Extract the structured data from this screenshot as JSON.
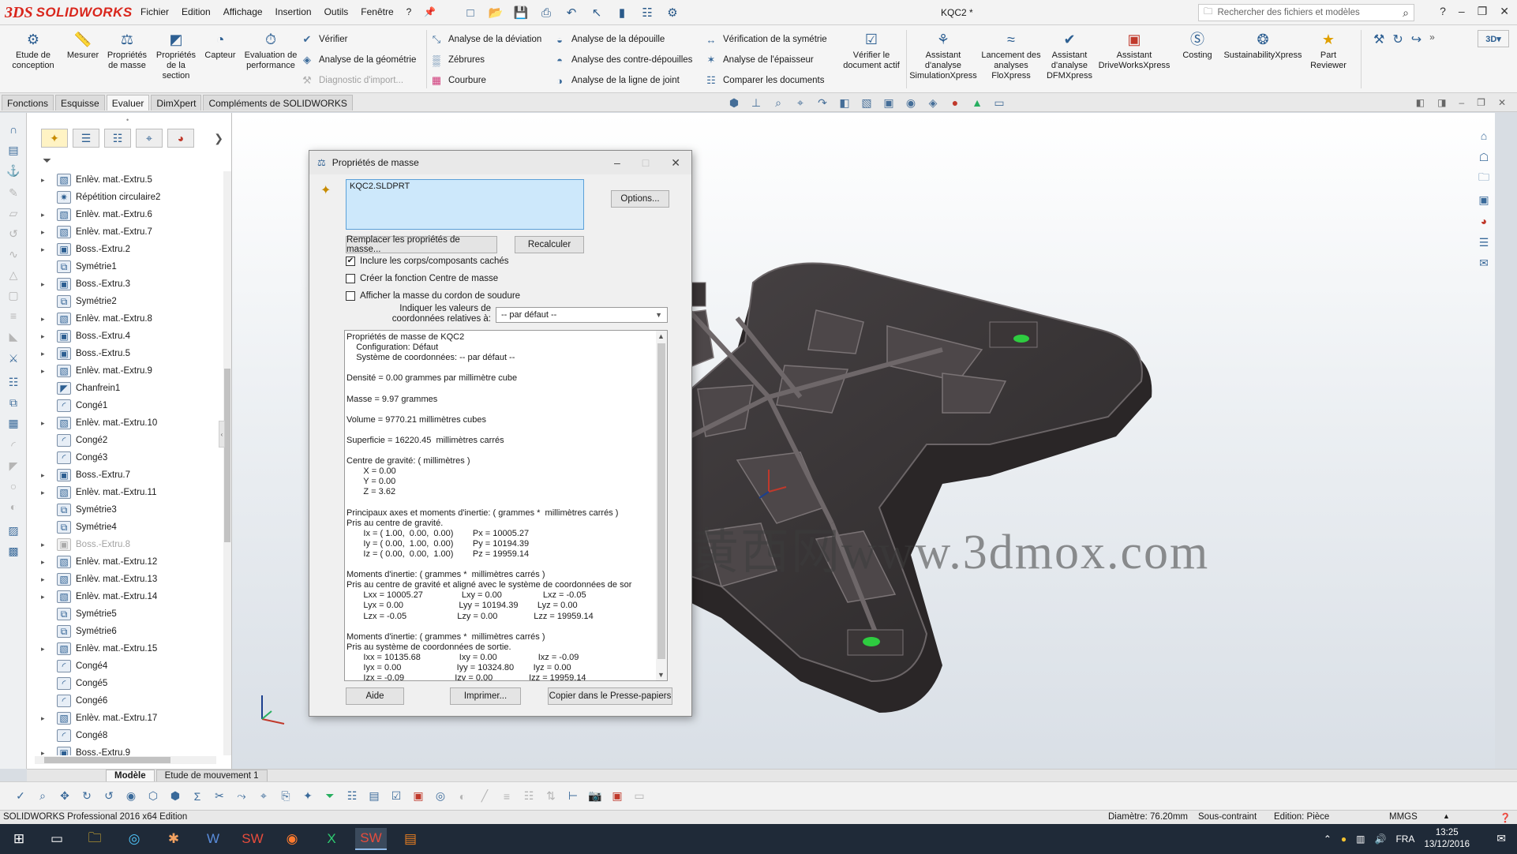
{
  "app": {
    "brand_ds": "3DS",
    "brand_name": "SOLIDWORKS",
    "document_title": "KQC2 *",
    "menu": [
      "Fichier",
      "Edition",
      "Affichage",
      "Insertion",
      "Outils",
      "Fenêtre",
      "?"
    ],
    "search_placeholder": "Rechercher des fichiers et modèles",
    "quick_icons": [
      "new-doc-icon",
      "open-icon",
      "save-icon",
      "print-icon",
      "undo-icon",
      "select-icon",
      "rebuild-icon",
      "file-props-icon",
      "options-icon"
    ]
  },
  "ribbon": {
    "large_buttons": [
      {
        "label": "Etude de conception",
        "icon": "design-study-icon"
      },
      {
        "label": "Mesurer",
        "icon": "measure-icon"
      },
      {
        "label": "Propriétés de masse",
        "icon": "mass-properties-icon"
      },
      {
        "label": "Propriétés de la section",
        "icon": "section-properties-icon"
      },
      {
        "label": "Capteur",
        "icon": "sensor-icon"
      },
      {
        "label": "Evaluation de performance",
        "icon": "performance-icon"
      }
    ],
    "col1": [
      {
        "label": "Vérifier",
        "icon": "check-icon",
        "disabled": false
      },
      {
        "label": "Analyse de la géométrie",
        "icon": "geometry-analysis-icon",
        "disabled": false
      },
      {
        "label": "Diagnostic d'import...",
        "icon": "import-diagnostics-icon",
        "disabled": true
      }
    ],
    "col2": [
      {
        "label": "Analyse de la déviation",
        "icon": "deviation-icon"
      },
      {
        "label": "Zébrures",
        "icon": "zebra-icon"
      },
      {
        "label": "Courbure",
        "icon": "curvature-icon"
      }
    ],
    "col3": [
      {
        "label": "Analyse de la dépouille",
        "icon": "draft-analysis-icon"
      },
      {
        "label": "Analyse des contre-dépouilles",
        "icon": "undercut-icon"
      },
      {
        "label": "Analyse de la ligne de joint",
        "icon": "parting-line-icon"
      }
    ],
    "col4": [
      {
        "label": "Vérification de la symétrie",
        "icon": "symmetry-check-icon"
      },
      {
        "label": "Analyse de l'épaisseur",
        "icon": "thickness-icon"
      },
      {
        "label": "Comparer les documents",
        "icon": "compare-icon"
      }
    ],
    "right_buttons": [
      {
        "label": "Vérifier le document actif",
        "icon": "check-active-doc-icon"
      },
      {
        "label": "Assistant d'analyse SimulationXpress",
        "icon": "simulationxpress-icon"
      },
      {
        "label": "Lancement des analyses FloXpress",
        "icon": "floxpress-icon"
      },
      {
        "label": "Assistant d'analyse DFMXpress",
        "icon": "dfmxpress-icon"
      },
      {
        "label": "Assistant DriveWorksXpress",
        "icon": "driveworks-icon"
      },
      {
        "label": "Costing",
        "icon": "costing-icon"
      },
      {
        "label": "SustainabilityXpress",
        "icon": "sustainability-icon"
      },
      {
        "label": "Part Reviewer",
        "icon": "part-reviewer-icon"
      }
    ]
  },
  "command_tabs": [
    {
      "label": "Fonctions",
      "active": false
    },
    {
      "label": "Esquisse",
      "active": false
    },
    {
      "label": "Evaluer",
      "active": true
    },
    {
      "label": "DimXpert",
      "active": false
    },
    {
      "label": "Compléments de SOLIDWORKS",
      "active": false
    }
  ],
  "tree": [
    {
      "label": "Enlèv. mat.-Extru.5",
      "expandable": true,
      "dim": false,
      "icon": "cut-extrude-icon"
    },
    {
      "label": "Répétition circulaire2",
      "expandable": false,
      "dim": false,
      "icon": "circular-pattern-icon"
    },
    {
      "label": "Enlèv. mat.-Extru.6",
      "expandable": true,
      "dim": false,
      "icon": "cut-extrude-icon"
    },
    {
      "label": "Enlèv. mat.-Extru.7",
      "expandable": true,
      "dim": false,
      "icon": "cut-extrude-icon"
    },
    {
      "label": "Boss.-Extru.2",
      "expandable": true,
      "dim": false,
      "icon": "boss-extrude-icon"
    },
    {
      "label": "Symétrie1",
      "expandable": false,
      "dim": false,
      "icon": "mirror-icon"
    },
    {
      "label": "Boss.-Extru.3",
      "expandable": true,
      "dim": false,
      "icon": "boss-extrude-icon"
    },
    {
      "label": "Symétrie2",
      "expandable": false,
      "dim": false,
      "icon": "mirror-icon"
    },
    {
      "label": "Enlèv. mat.-Extru.8",
      "expandable": true,
      "dim": false,
      "icon": "cut-extrude-icon"
    },
    {
      "label": "Boss.-Extru.4",
      "expandable": true,
      "dim": false,
      "icon": "boss-extrude-icon"
    },
    {
      "label": "Boss.-Extru.5",
      "expandable": true,
      "dim": false,
      "icon": "boss-extrude-icon"
    },
    {
      "label": "Enlèv. mat.-Extru.9",
      "expandable": true,
      "dim": false,
      "icon": "cut-extrude-icon"
    },
    {
      "label": "Chanfrein1",
      "expandable": false,
      "dim": false,
      "icon": "chamfer-icon"
    },
    {
      "label": "Congé1",
      "expandable": false,
      "dim": false,
      "icon": "fillet-icon"
    },
    {
      "label": "Enlèv. mat.-Extru.10",
      "expandable": true,
      "dim": false,
      "icon": "cut-extrude-icon"
    },
    {
      "label": "Congé2",
      "expandable": false,
      "dim": false,
      "icon": "fillet-icon"
    },
    {
      "label": "Congé3",
      "expandable": false,
      "dim": false,
      "icon": "fillet-icon"
    },
    {
      "label": "Boss.-Extru.7",
      "expandable": true,
      "dim": false,
      "icon": "boss-extrude-icon"
    },
    {
      "label": "Enlèv. mat.-Extru.11",
      "expandable": true,
      "dim": false,
      "icon": "cut-extrude-icon"
    },
    {
      "label": "Symétrie3",
      "expandable": false,
      "dim": false,
      "icon": "mirror-icon"
    },
    {
      "label": "Symétrie4",
      "expandable": false,
      "dim": false,
      "icon": "mirror-icon"
    },
    {
      "label": "Boss.-Extru.8",
      "expandable": true,
      "dim": true,
      "icon": "boss-extrude-icon"
    },
    {
      "label": "Enlèv. mat.-Extru.12",
      "expandable": true,
      "dim": false,
      "icon": "cut-extrude-icon"
    },
    {
      "label": "Enlèv. mat.-Extru.13",
      "expandable": true,
      "dim": false,
      "icon": "cut-extrude-icon"
    },
    {
      "label": "Enlèv. mat.-Extru.14",
      "expandable": true,
      "dim": false,
      "icon": "cut-extrude-icon"
    },
    {
      "label": "Symétrie5",
      "expandable": false,
      "dim": false,
      "icon": "mirror-icon"
    },
    {
      "label": "Symétrie6",
      "expandable": false,
      "dim": false,
      "icon": "mirror-icon"
    },
    {
      "label": "Enlèv. mat.-Extru.15",
      "expandable": true,
      "dim": false,
      "icon": "cut-extrude-icon"
    },
    {
      "label": "Congé4",
      "expandable": false,
      "dim": false,
      "icon": "fillet-icon"
    },
    {
      "label": "Congé5",
      "expandable": false,
      "dim": false,
      "icon": "fillet-icon"
    },
    {
      "label": "Congé6",
      "expandable": false,
      "dim": false,
      "icon": "fillet-icon"
    },
    {
      "label": "Enlèv. mat.-Extru.17",
      "expandable": true,
      "dim": false,
      "icon": "cut-extrude-icon"
    },
    {
      "label": "Congé8",
      "expandable": false,
      "dim": false,
      "icon": "fillet-icon"
    },
    {
      "label": "Boss.-Extru.9",
      "expandable": true,
      "dim": false,
      "icon": "boss-extrude-icon"
    }
  ],
  "dialog": {
    "title": "Propriétés de masse",
    "selection": "KQC2.SLDPRT",
    "options_button": "Options...",
    "override_button": "Remplacer les propriétés de masse...",
    "recalc_button": "Recalculer",
    "check_hidden": {
      "label": "Inclure les corps/composants cachés",
      "checked": true
    },
    "check_com": {
      "label": "Créer la fonction Centre de masse",
      "checked": false
    },
    "check_weld": {
      "label": "Afficher la masse du cordon de soudure",
      "checked": false
    },
    "coord_label": "Indiquer les valeurs de coordonnées relatives à:",
    "coord_value": "-- par défaut --",
    "results_text": "Propriétés de masse de KQC2\n    Configuration: Défaut\n    Système de coordonnées: -- par défaut --\n\nDensité = 0.00 grammes par millimètre cube\n\nMasse = 9.97 grammes\n\nVolume = 9770.21 millimètres cubes\n\nSuperficie = 16220.45  millimètres carrés\n\nCentre de gravité: ( millimètres )\n       X = 0.00\n       Y = 0.00\n       Z = 3.62\n\nPrincipaux axes et moments d'inertie: ( grammes *  millimètres carrés )\nPris au centre de gravité.\n       Ix = ( 1.00,  0.00,  0.00)        Px = 10005.27\n       Iy = ( 0.00,  1.00,  0.00)        Py = 10194.39\n       Iz = ( 0.00,  0.00,  1.00)        Pz = 19959.14\n\nMoments d'inertie: ( grammes *  millimètres carrés )\nPris au centre de gravité et aligné avec le système de coordonnées de sor\n       Lxx = 10005.27                Lxy = 0.00                 Lxz = -0.05\n       Lyx = 0.00                       Lyy = 10194.39        Lyz = 0.00\n       Lzx = -0.05                     Lzy = 0.00               Lzz = 19959.14\n\nMoments d'inertie: ( grammes *  millimètres carrés )\nPris au système de coordonnées de sortie.\n       Ixx = 10135.68                Ixy = 0.00                 Ixz = -0.09\n       Iyx = 0.00                       Iyy = 10324.80        Iyz = 0.00\n       Izx = -0.09                     Izy = 0.00               Izz = 19959.14",
    "help_button": "Aide",
    "print_button": "Imprimer...",
    "copy_button": "Copier dans le Presse-papiers"
  },
  "watermark": "黄西网www.3dmox.com",
  "bottom_tabs": [
    {
      "label": "Modèle",
      "active": true
    },
    {
      "label": "Etude de mouvement 1",
      "active": false
    }
  ],
  "status": {
    "edition": "SOLIDWORKS Professional 2016 x64 Edition",
    "diameter": "Diamètre: 76.20mm",
    "constraint": "Sous-contraint",
    "editing": "Edition: Pièce",
    "units": "MMGS"
  },
  "taskbar": {
    "lang": "FRA",
    "time": "13:25",
    "date": "13/12/2016"
  },
  "colors": {
    "brand_red": "#d9261c",
    "model_body": "#3a3638",
    "model_highlight": "#6b6567",
    "marker_green": "#2ecc40",
    "selection_fill": "#cde8fb"
  }
}
